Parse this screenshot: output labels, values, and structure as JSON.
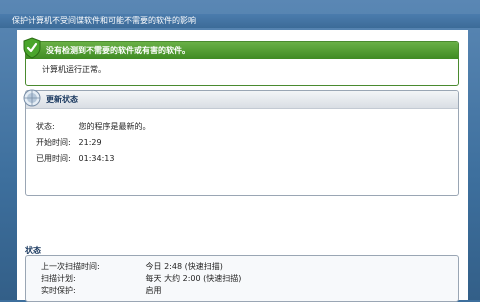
{
  "banner": {
    "text": "保护计算机不受间谍软件和可能不需要的软件的影响"
  },
  "ok_panel": {
    "header": "没有检测到不需要的软件或有害的软件。",
    "message": "计算机运行正常。"
  },
  "update_panel": {
    "header": "更新状态",
    "rows": [
      {
        "label": "状态:",
        "value": "您的程序是最新的。"
      },
      {
        "label": "开始时间:",
        "value": "21:29"
      },
      {
        "label": "已用时间:",
        "value": "01:34:13"
      }
    ]
  },
  "status_section": {
    "title": "状态",
    "rows": [
      {
        "label": "上一次扫描时间:",
        "value": "今日 2:48 (快速扫描)"
      },
      {
        "label": "扫描计划:",
        "value": "每天 大约 2:00 (快速扫描)"
      },
      {
        "label": "实时保护:",
        "value": "启用"
      }
    ]
  },
  "colors": {
    "ok_green": "#3f8b23",
    "frame_blue": "#3d6f9d"
  }
}
